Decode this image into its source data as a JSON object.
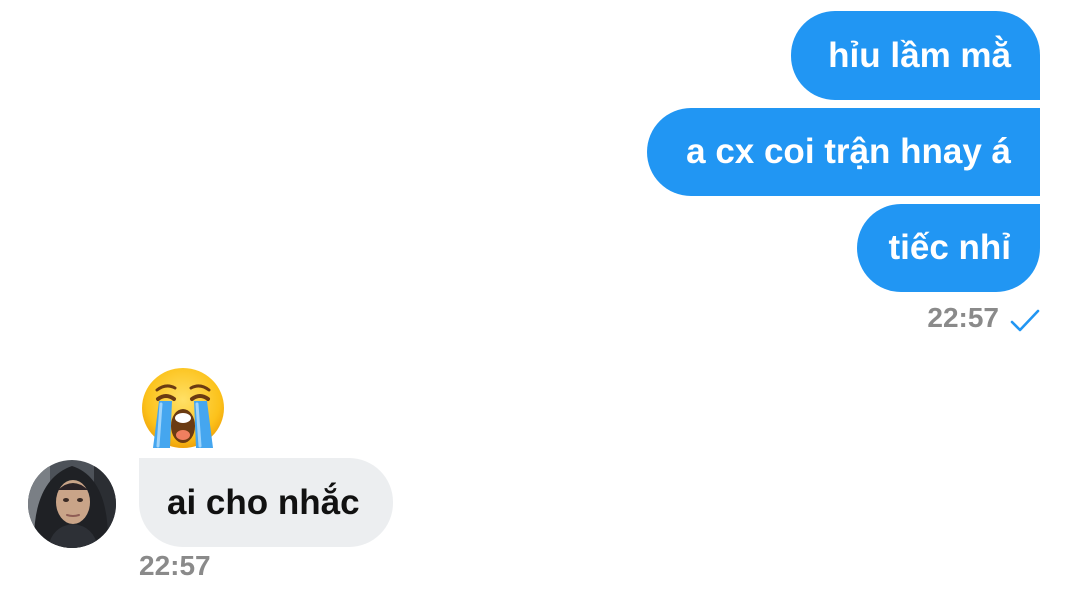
{
  "outgoing": {
    "messages": [
      {
        "text": "hỉu lầm mằ"
      },
      {
        "text": "a cx coi trận hnay á"
      },
      {
        "text": "tiếc nhỉ"
      }
    ],
    "time": "22:57",
    "status_icon": "single-check-icon"
  },
  "incoming": {
    "emoji": "loudly-crying-face",
    "messages": [
      {
        "text": "ai cho nhắc"
      }
    ],
    "time": "22:57"
  },
  "colors": {
    "outgoing_bubble": "#2196f3",
    "incoming_bubble": "#eceef0",
    "timestamp": "#8a8a8a",
    "check": "#2196f3"
  }
}
